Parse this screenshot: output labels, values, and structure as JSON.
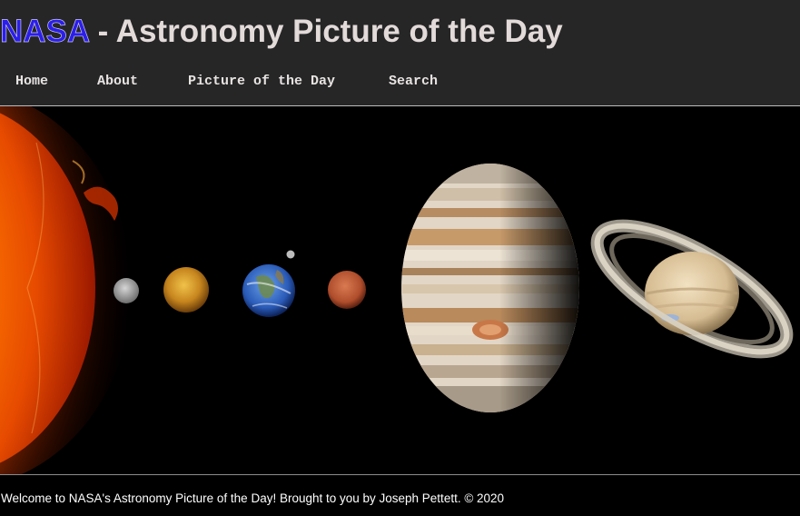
{
  "header": {
    "brand": "NASA",
    "title_rest": " - Astronomy Picture of the Day"
  },
  "nav": {
    "items": [
      {
        "label": "Home"
      },
      {
        "label": "About"
      },
      {
        "label": "Picture of the Day"
      },
      {
        "label": "Search"
      }
    ]
  },
  "footer": {
    "text": "Welcome to NASA's Astronomy Picture of the Day! Brought to you by Joseph Pettett. © 2020"
  },
  "colors": {
    "header_bg": "#262626",
    "brand": "#2b1fe6",
    "title": "#e3dada",
    "page_bg": "#000000"
  }
}
